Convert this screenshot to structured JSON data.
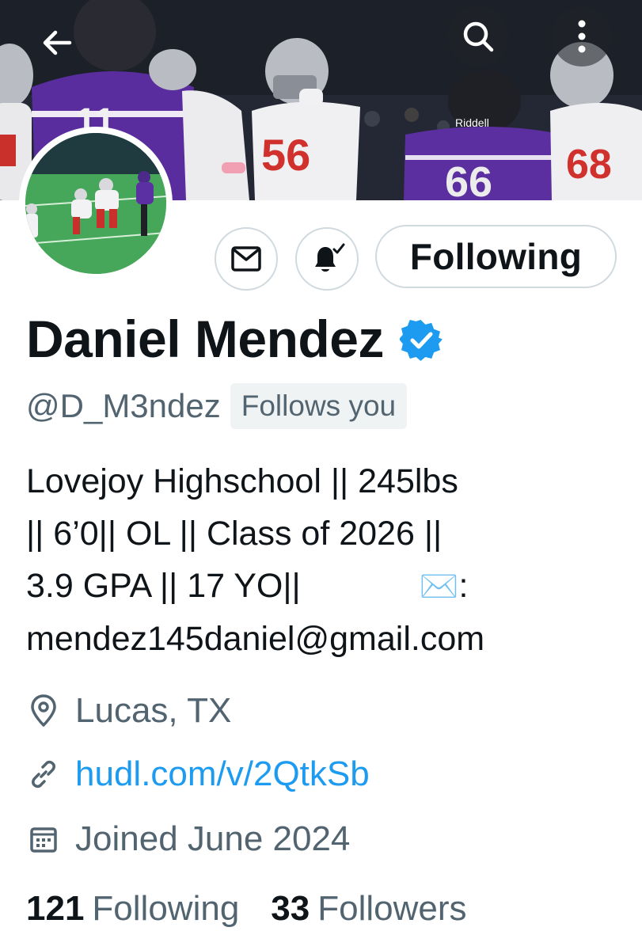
{
  "header": {
    "back_icon": "arrow-left-icon",
    "search_icon": "search-icon",
    "more_icon": "more-vertical-icon",
    "banner_jersey_numbers": [
      "11",
      "56",
      "66",
      "68"
    ]
  },
  "actions": {
    "message_icon": "mail-icon",
    "notify_icon": "bell-subscribed-icon",
    "follow_state_label": "Following"
  },
  "profile": {
    "display_name": "Daniel Mendez",
    "verified": true,
    "verified_color": "#1d9bf0",
    "handle": "@D_M3ndez",
    "follows_you_badge": "Follows you",
    "bio_lines": [
      "Lovejoy Highschool || 245lbs",
      "|| 6’0|| OL || Class of 2026 ||",
      "3.9 GPA || 17 YO||",
      "mendez145daniel@gmail.com"
    ],
    "bio_envelope_emoji": "✉️",
    "bio_envelope_suffix": ":",
    "location": "Lucas, TX",
    "website": "hudl.com/v/2QtkSb",
    "joined": "Joined June 2024",
    "link_color": "#1d9bf0"
  },
  "stats": {
    "following_count": "121",
    "following_label": "Following",
    "followers_count": "33",
    "followers_label": "Followers"
  }
}
